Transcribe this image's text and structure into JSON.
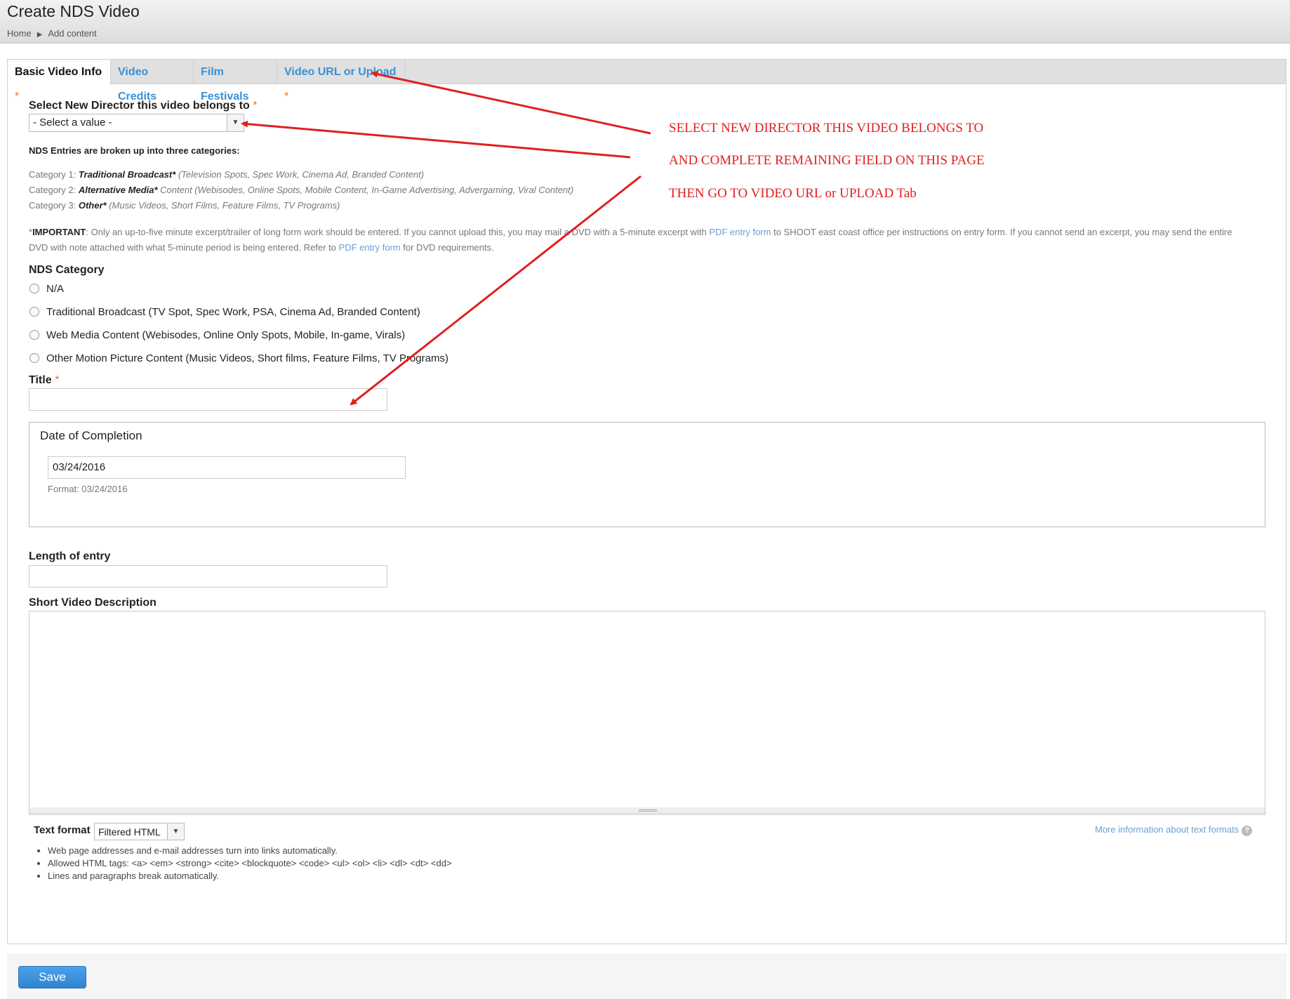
{
  "header": {
    "title": "Create NDS Video",
    "breadcrumb": [
      "Home",
      "Add content"
    ],
    "breadcrumb_sep": "▶"
  },
  "tabs": [
    {
      "label": "Basic Video Info",
      "required": "*",
      "active": true
    },
    {
      "label": "Video Credits",
      "required": "",
      "active": false
    },
    {
      "label": "Film Festivals",
      "required": "",
      "active": false
    },
    {
      "label": "Video URL or Upload",
      "required": "*",
      "active": false
    }
  ],
  "director": {
    "label": "Select New Director this video belongs to",
    "required": "*",
    "value": "- Select a value -"
  },
  "categories_intro": "NDS Entries are broken up into three categories:",
  "categories": [
    {
      "prefix": "Category 1:",
      "name": "Traditional Broadcast*",
      "desc": "(Television Spots, Spec Work, Cinema Ad, Branded Content)"
    },
    {
      "prefix": "Category 2:",
      "name": "Alternative Media*",
      "desc": "Content (Webisodes, Online Spots, Mobile Content, In-Game Advertising, Advergaming, Viral Content)"
    },
    {
      "prefix": "Category 3:",
      "name": "Other*",
      "desc": "(Music Videos, Short Films, Feature Films, TV Programs)"
    }
  ],
  "important": {
    "star": "*",
    "bold": "IMPORTANT",
    "text1": ": Only an up-to-five minute excerpt/trailer of long form work should be entered. If you cannot upload this, you may mail a DVD with a 5-minute excerpt with ",
    "link1": "PDF entry form",
    "text2": " to SHOOT east coast office per instructions on entry form. If you cannot send an excerpt, you may send the entire",
    "text3": "DVD with note attached with what 5-minute period is being entered. Refer to ",
    "link2": "PDF entry form",
    "text4": " for DVD requirements."
  },
  "nds_category": {
    "label": "NDS Category",
    "options": [
      "N/A",
      "Traditional Broadcast (TV Spot, Spec Work, PSA, Cinema Ad, Branded Content)",
      "Web Media Content (Webisodes, Online Only Spots, Mobile, In-game, Virals)",
      "Other Motion Picture Content (Music Videos, Short films, Feature Films, TV Programs)"
    ]
  },
  "title_field": {
    "label": "Title",
    "required": "*",
    "value": ""
  },
  "date": {
    "legend": "Date of Completion",
    "value": "03/24/2016",
    "format": "Format: 03/24/2016"
  },
  "length": {
    "label": "Length of entry",
    "value": ""
  },
  "description": {
    "label": "Short Video Description",
    "value": ""
  },
  "text_format": {
    "label": "Text format",
    "value": "Filtered HTML",
    "more_info": "More information about text formats",
    "help_icon": "?",
    "tips": [
      "Web page addresses and e-mail addresses turn into links automatically.",
      "Allowed HTML tags: <a> <em> <strong> <cite> <blockquote> <code> <ul> <ol> <li> <dl> <dt> <dd>",
      "Lines and paragraphs break automatically."
    ]
  },
  "save_label": "Save",
  "annotations": [
    "SELECT NEW DIRECTOR THIS VIDEO BELONGS TO",
    "AND COMPLETE REMAINING FIELD ON THIS PAGE",
    "THEN GO TO VIDEO URL or UPLOAD Tab"
  ],
  "colors": {
    "annotation": "#e02020",
    "link": "#3a91d6",
    "required": "#e8742d",
    "save": "#3a91d6"
  }
}
